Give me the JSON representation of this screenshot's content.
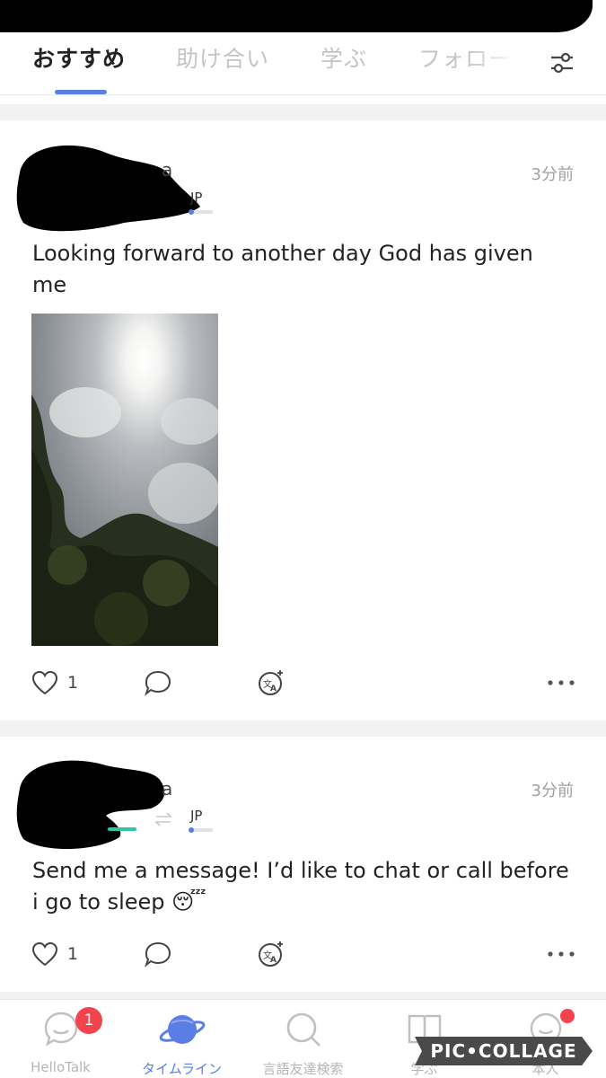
{
  "top_tabs": [
    {
      "label": "おすすめ",
      "active": true
    },
    {
      "label": "助け合い",
      "active": false
    },
    {
      "label": "学ぶ",
      "active": false
    },
    {
      "label": "フォロー",
      "active": false
    }
  ],
  "accent_color": "#5b7ee5",
  "posts": [
    {
      "username_visible": "a",
      "learning_lang": "JP",
      "time": "3分前",
      "text": "Looking forward to another day God has given me",
      "has_photo": true,
      "likes": "1"
    },
    {
      "username_visible": "a",
      "learning_lang": "JP",
      "time": "3分前",
      "text": "Send me a message! I’d like to chat or call before i go to sleep 😴",
      "has_photo": false,
      "likes": "1"
    }
  ],
  "tabbar": [
    {
      "label": "HelloTalk",
      "icon": "chat-bubble-icon",
      "badge": "1"
    },
    {
      "label": "タイムライン",
      "icon": "planet-icon",
      "active": true
    },
    {
      "label": "言語友達検索",
      "icon": "search-icon"
    },
    {
      "label": "学ぶ",
      "icon": "book-icon"
    },
    {
      "label": "本人",
      "icon": "profile-icon",
      "dot": true
    }
  ],
  "watermark": "PIC•COLLAGE"
}
